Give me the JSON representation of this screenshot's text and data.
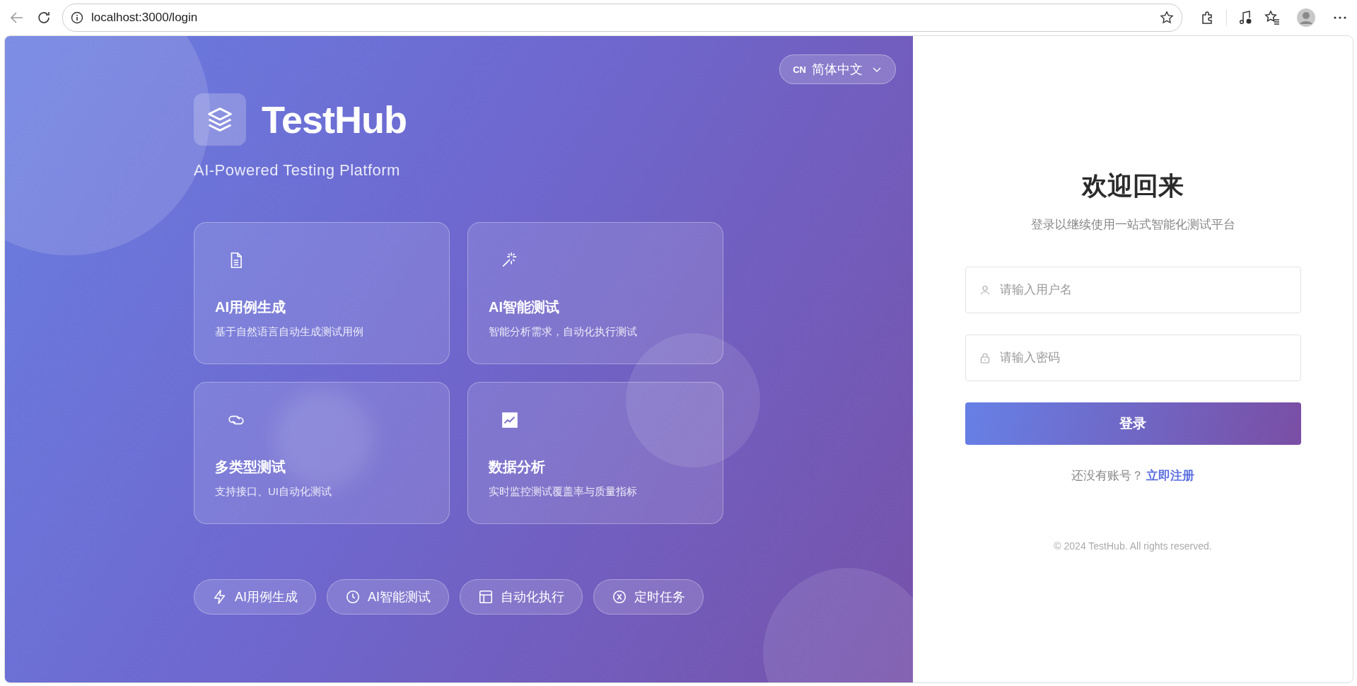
{
  "browser": {
    "url": "localhost:3000/login"
  },
  "language": {
    "code": "CN",
    "label": "简体中文"
  },
  "brand": {
    "name": "TestHub",
    "tagline": "AI-Powered Testing Platform"
  },
  "features": [
    {
      "kind": "document",
      "title": "AI用例生成",
      "description": "基于自然语言自动生成测试用例"
    },
    {
      "kind": "sparkle",
      "title": "AI智能测试",
      "description": "智能分析需求，自动化执行测试"
    },
    {
      "kind": "link",
      "title": "多类型测试",
      "description": "支持接口、UI自动化测试"
    },
    {
      "kind": "chart",
      "title": "数据分析",
      "description": "实时监控测试覆盖率与质量指标"
    }
  ],
  "tags": [
    {
      "kind": "bolt",
      "label": "AI用例生成"
    },
    {
      "kind": "clock",
      "label": "AI智能测试"
    },
    {
      "kind": "layout",
      "label": "自动化执行"
    },
    {
      "kind": "cross",
      "label": "定时任务"
    }
  ],
  "login": {
    "title": "欢迎回来",
    "subtitle": "登录以继续使用一站式智能化测试平台",
    "username": {
      "placeholder": "请输入用户名"
    },
    "password": {
      "placeholder": "请输入密码"
    },
    "submit": "登录",
    "register_prompt": "还没有账号？",
    "register_link": "立即注册",
    "footer": "© 2024 TestHub. All rights reserved."
  }
}
